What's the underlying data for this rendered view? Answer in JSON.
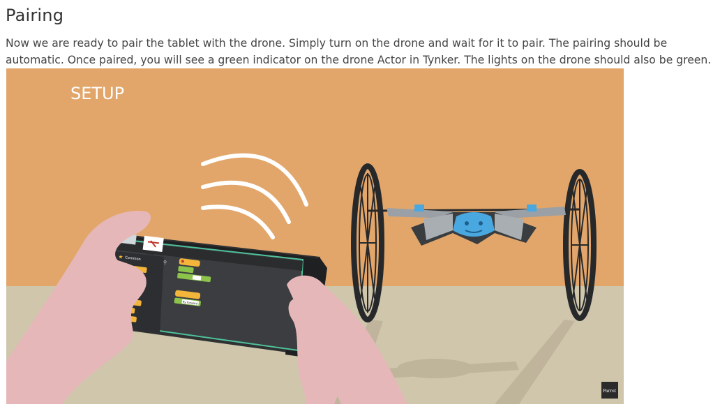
{
  "section": {
    "title": "Pairing",
    "body": "Now we are ready to pair the tablet with the drone. Simply turn on the drone and wait for it to pair. The pairing should be automatic. Once paired, you will see a green indicator on the drone Actor in Tynker. The lights on the drone should also be green."
  },
  "illustration": {
    "setup_label": "SETUP",
    "brand_badge": "Parrot",
    "tablet": {
      "category_label": "Common",
      "actor_label": "drone",
      "script_action_label": "fly forward"
    },
    "colors": {
      "wall": "#e2a66b",
      "floor": "#cfc6ac",
      "hands": "#e6b7b9",
      "tablet_body": "#2f3133",
      "screen_outline": "#4fc29a",
      "block_yellow": "#f3b63b",
      "block_green": "#8cc34b",
      "drone_accent": "#4aa8e0",
      "wheel": "#26282a"
    },
    "icons": [
      "signal-waves-icon",
      "drone-icon",
      "star-icon",
      "search-icon"
    ]
  }
}
